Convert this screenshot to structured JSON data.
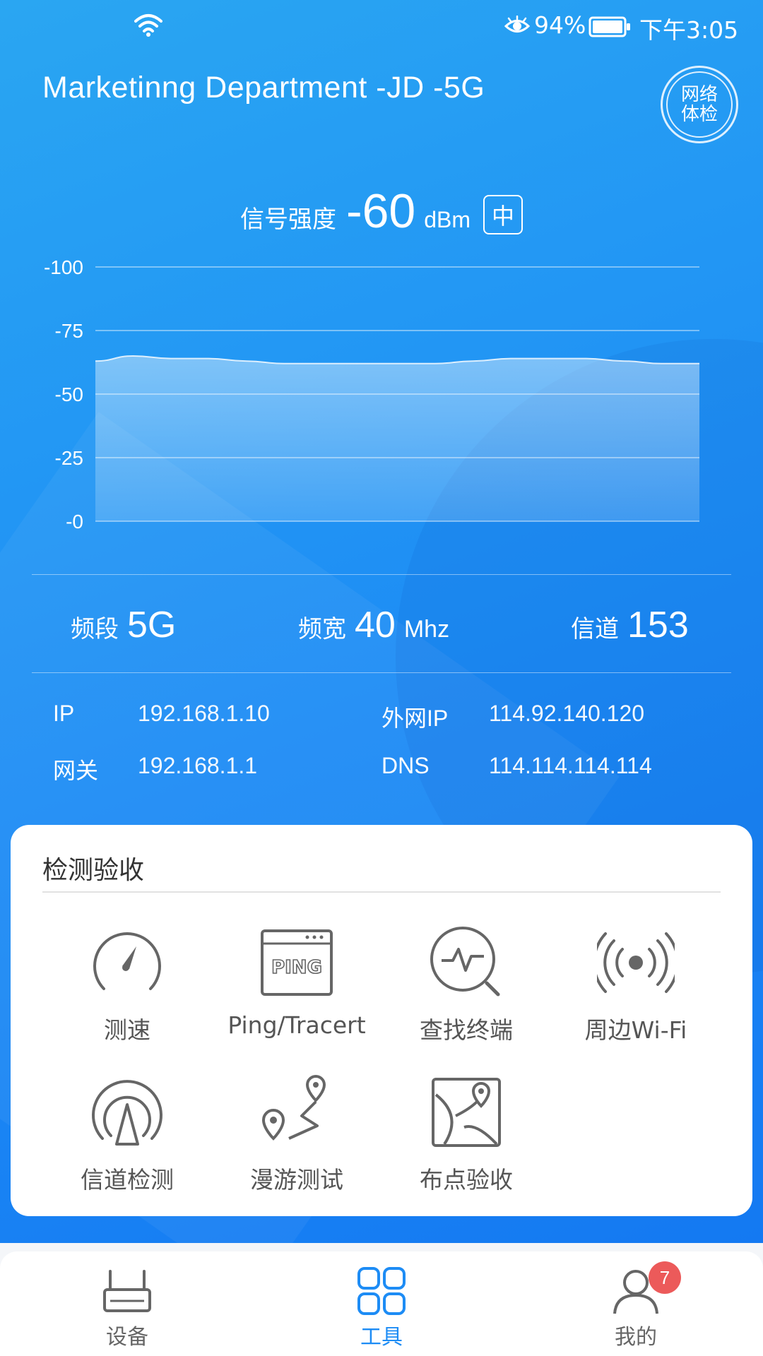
{
  "status_bar": {
    "battery": "94%",
    "time": "下午3:05"
  },
  "header": {
    "ssid": "Marketinng Department -JD -5G",
    "diagnose_button": "网络体检"
  },
  "signal": {
    "label": "信号强度",
    "value": "-60",
    "unit": "dBm",
    "level": "中"
  },
  "chart_data": {
    "type": "area",
    "y_ticks": [
      "-100",
      "-75",
      "-50",
      "-25",
      "-0"
    ],
    "ylim": [
      0,
      -100
    ],
    "series": [
      {
        "values": [
          -63,
          -65,
          -64,
          -64,
          -63,
          -62,
          -62,
          -62,
          -62,
          -62,
          -63,
          -64,
          -64,
          -64,
          -63,
          -62,
          -62
        ]
      }
    ],
    "grid": true
  },
  "network": {
    "band_label": "频段",
    "band_value": "5G",
    "width_label": "频宽",
    "width_value": "40",
    "width_unit": "Mhz",
    "channel_label": "信道",
    "channel_value": "153",
    "ip_label": "IP",
    "ip_value": "192.168.1.10",
    "wan_ip_label": "外网IP",
    "wan_ip_value": "114.92.140.120",
    "gateway_label": "网关",
    "gateway_value": "192.168.1.1",
    "dns_label": "DNS",
    "dns_value": "114.114.114.114"
  },
  "tools": {
    "title": "检测验收",
    "items": [
      {
        "label": "测速",
        "icon": "speedometer-icon"
      },
      {
        "label": "Ping/Tracert",
        "icon": "ping-window-icon",
        "icon_text": "PING"
      },
      {
        "label": "查找终端",
        "icon": "search-pulse-icon"
      },
      {
        "label": "周边Wi-Fi",
        "icon": "broadcast-icon"
      },
      {
        "label": "信道检测",
        "icon": "channel-antenna-icon"
      },
      {
        "label": "漫游测试",
        "icon": "route-pins-icon"
      },
      {
        "label": "布点验收",
        "icon": "map-pin-icon"
      }
    ]
  },
  "bottom_nav": {
    "items": [
      {
        "label": "设备",
        "icon": "router-icon",
        "active": false
      },
      {
        "label": "工具",
        "icon": "grid-icon",
        "active": true
      },
      {
        "label": "我的",
        "icon": "user-icon",
        "active": false,
        "badge": "7"
      }
    ]
  },
  "colors": {
    "accent": "#1d8cf5",
    "badge": "#ec5a5a"
  }
}
